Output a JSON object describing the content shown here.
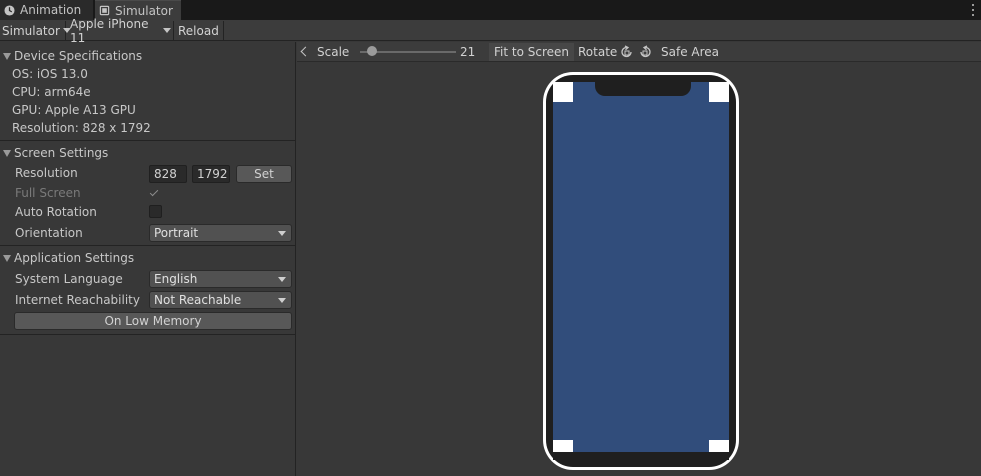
{
  "tabs": [
    {
      "label": "Animation",
      "icon": "animation-clock-icon",
      "active": false
    },
    {
      "label": "Simulator",
      "icon": "simulator-device-icon",
      "active": true
    }
  ],
  "toolbar": {
    "mode_label": "Simulator",
    "device_label": "Apple iPhone 11",
    "reload_label": "Reload"
  },
  "device_specs": {
    "heading": "Device Specifications",
    "os": "OS: iOS 13.0",
    "cpu": "CPU: arm64e",
    "gpu": "GPU: Apple A13 GPU",
    "resolution": "Resolution: 828 x 1792"
  },
  "screen_settings": {
    "heading": "Screen Settings",
    "resolution_label": "Resolution",
    "width": "828",
    "height": "1792",
    "set_label": "Set",
    "full_screen_label": "Full Screen",
    "full_screen_checked": true,
    "auto_rotation_label": "Auto Rotation",
    "auto_rotation_checked": false,
    "orientation_label": "Orientation",
    "orientation_value": "Portrait"
  },
  "app_settings": {
    "heading": "Application Settings",
    "language_label": "System Language",
    "language_value": "English",
    "reachability_label": "Internet Reachability",
    "reachability_value": "Not Reachable",
    "low_memory_label": "On Low Memory"
  },
  "view_toolbar": {
    "scale_label": "Scale",
    "scale_value": "21",
    "fit_label": "Fit to Screen",
    "rotate_label": "Rotate",
    "safe_area_label": "Safe Area"
  },
  "colors": {
    "screen_fill": "#314d7b",
    "panel_bg": "#383838"
  }
}
